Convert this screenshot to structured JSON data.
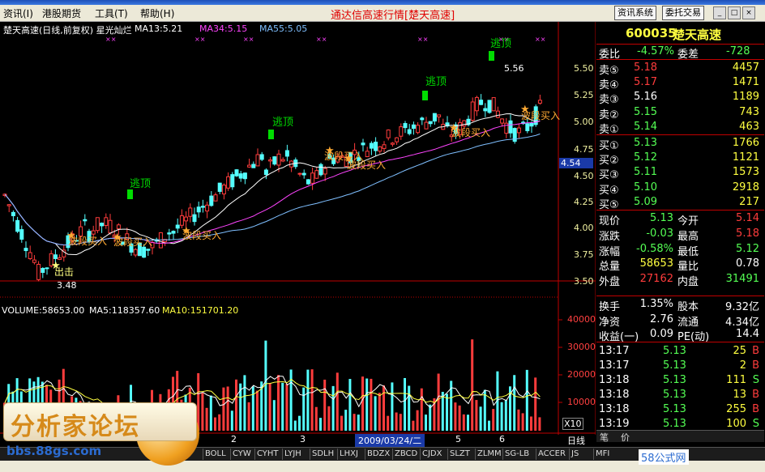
{
  "menu": {
    "items": [
      "资讯(I)",
      "港股期货",
      "工具(T)",
      "帮助(H)"
    ],
    "center_title": "通达信高速行情[楚天高速]",
    "btn_info": "资讯系统",
    "btn_trade": "委托交易"
  },
  "chart_header": {
    "title": "楚天高速(日线,前复权) 星光灿烂",
    "ma13": "MA13:5.21",
    "ma34": "MA34:5.15",
    "ma55": "MA55:5.05"
  },
  "volume_header": {
    "volume": "VOLUME:58653.00",
    "ma5": "MA5:118357.60",
    "ma10": "MA10:151701.20"
  },
  "price_axis": [
    "5.50",
    "5.25",
    "5.00",
    "4.75",
    "4.50",
    "4.25",
    "4.00",
    "3.75",
    "3.50"
  ],
  "current_axis_value": "4.54",
  "volume_axis": [
    "40000",
    "30000",
    "20000",
    "10000"
  ],
  "x10_label": "X10",
  "period_label": "日线",
  "date_label": "2009/03/24/二",
  "month_labels": [
    "2",
    "3",
    "5",
    "6"
  ],
  "annotations": {
    "sell": "逃顶",
    "buy": "波段买入",
    "hit": "出击",
    "low_price": "3.48",
    "high_price": "5.56"
  },
  "quote": {
    "code": "600035",
    "name": "楚天高速",
    "webi_label": "委比",
    "webi_value": "-4.57%",
    "wecha_label": "委差",
    "wecha_value": "-728",
    "sells": [
      {
        "label": "卖⑤",
        "price": "5.18",
        "vol": "4457"
      },
      {
        "label": "卖④",
        "price": "5.17",
        "vol": "1471"
      },
      {
        "label": "卖③",
        "price": "5.16",
        "vol": "1189"
      },
      {
        "label": "卖②",
        "price": "5.15",
        "vol": "743"
      },
      {
        "label": "卖①",
        "price": "5.14",
        "vol": "463"
      }
    ],
    "buys": [
      {
        "label": "买①",
        "price": "5.13",
        "vol": "1766"
      },
      {
        "label": "买②",
        "price": "5.12",
        "vol": "1121"
      },
      {
        "label": "买③",
        "price": "5.11",
        "vol": "1573"
      },
      {
        "label": "买④",
        "price": "5.10",
        "vol": "2918"
      },
      {
        "label": "买⑤",
        "price": "5.09",
        "vol": "217"
      }
    ],
    "stats": [
      {
        "l1": "现价",
        "v1": "5.13",
        "l2": "今开",
        "v2": "5.14"
      },
      {
        "l1": "涨跌",
        "v1": "-0.03",
        "l2": "最高",
        "v2": "5.18"
      },
      {
        "l1": "涨幅",
        "v1": "-0.58%",
        "l2": "最低",
        "v2": "5.12"
      },
      {
        "l1": "总量",
        "v1": "58653",
        "l2": "量比",
        "v2": "0.78"
      },
      {
        "l1": "外盘",
        "v1": "27162",
        "l2": "内盘",
        "v2": "31491"
      }
    ],
    "stats2": [
      {
        "l1": "换手",
        "v1": "1.35%",
        "l2": "股本",
        "v2": "9.32亿"
      },
      {
        "l1": "净资",
        "v1": "2.76",
        "l2": "流通",
        "v2": "4.34亿"
      },
      {
        "l1": "收益(一)",
        "v1": "0.09",
        "l2": "PE(动)",
        "v2": "14.4"
      }
    ],
    "ticks": [
      {
        "time": "13:17",
        "price": "5.13",
        "vol": "25",
        "side": "B"
      },
      {
        "time": "13:17",
        "price": "5.13",
        "vol": "2",
        "side": "B"
      },
      {
        "time": "13:18",
        "price": "5.13",
        "vol": "111",
        "side": "S"
      },
      {
        "time": "13:18",
        "price": "5.13",
        "vol": "13",
        "side": "B"
      },
      {
        "time": "13:18",
        "price": "5.13",
        "vol": "255",
        "side": "B"
      },
      {
        "time": "13:19",
        "price": "5.13",
        "vol": "100",
        "side": "S"
      }
    ],
    "tabs": [
      "笔",
      "价"
    ]
  },
  "bottom_tabs": [
    "BOLL",
    "CYW",
    "CYHT",
    "LYJH",
    "SDLH",
    "LHXJ",
    "BDZX",
    "ZBCD",
    "CJDX",
    "SLZT",
    "ZLMM",
    "SG-LB",
    "ACCER",
    "JS",
    "MFI"
  ],
  "watermark": {
    "main": "分析家论坛",
    "site": "bbs.88gs.com",
    "right": "58公式网"
  },
  "colors": {
    "up": "#ff3c3c",
    "down": "#54ffff",
    "ma13": "#ffffff",
    "ma34": "#ff44ff",
    "ma55": "#7fbfff",
    "signal_green": "#00dd00",
    "buy_orange": "#ffaa33",
    "axis_red": "#c00000"
  }
}
